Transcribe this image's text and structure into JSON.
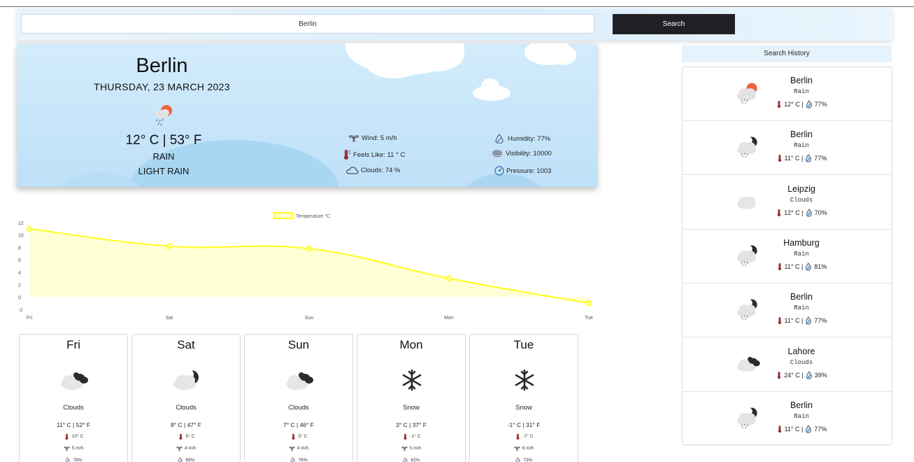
{
  "search": {
    "value": "Berlin",
    "button_label": "Search"
  },
  "current": {
    "city": "Berlin",
    "date": "THURSDAY, 23 MARCH 2023",
    "temp": "12° C | 53° F",
    "condition": "RAIN",
    "description": "LIGHT RAIN",
    "wind": "Wind: 5 m/h",
    "feels_like": "Feels Like: 11 ° C",
    "clouds": "Clouds: 74 %",
    "humidity": "Humidity: 77%",
    "visibility": "Visibility: 10000",
    "pressure": "Pressure: 1003"
  },
  "chart_data": {
    "type": "line",
    "categories": [
      "Fri",
      "Sat",
      "Sun",
      "Mon",
      "Tue"
    ],
    "series": [
      {
        "name": "Temperature °C",
        "values": [
          11,
          8.2,
          7.8,
          3,
          -1
        ]
      }
    ],
    "ylim": [
      -2,
      12
    ],
    "yticks": [
      -2,
      0,
      2,
      4,
      6,
      8,
      10,
      12
    ],
    "legend": "top-center",
    "fill": true,
    "line_color": "#ffff1a",
    "fill_color": "#ffffd6"
  },
  "forecast": [
    {
      "day": "Fri",
      "icon": "cloud-night-icon",
      "condition": "Clouds",
      "temp": "11° C | 52° F",
      "feels": "10° C",
      "wind": "5 m/h",
      "humidity": "78%"
    },
    {
      "day": "Sat",
      "icon": "cloud-moon-icon",
      "condition": "Clouds",
      "temp": "8° C | 47° F",
      "feels": "5° C",
      "wind": "4 m/h",
      "humidity": "69%"
    },
    {
      "day": "Sun",
      "icon": "cloud-night-icon",
      "condition": "Clouds",
      "temp": "7° C | 46° F",
      "feels": "5° C",
      "wind": "4 m/h",
      "humidity": "76%"
    },
    {
      "day": "Mon",
      "icon": "snowflake-icon",
      "condition": "Snow",
      "temp": "3° C | 37° F",
      "feels": "-1° C",
      "wind": "5 m/h",
      "humidity": "62%"
    },
    {
      "day": "Tue",
      "icon": "snowflake-icon",
      "condition": "Snow",
      "temp": "-1° C | 31° F",
      "feels": "-7° C",
      "wind": "6 m/h",
      "humidity": "73%"
    }
  ],
  "history": {
    "title": "Search History",
    "items": [
      {
        "city": "Berlin",
        "condition": "Rain",
        "temp": "12° C |",
        "humidity": "77%",
        "icon": "rain-sun-icon"
      },
      {
        "city": "Berlin",
        "condition": "Rain",
        "temp": "11° C |",
        "humidity": "77%",
        "icon": "rain-moon-icon"
      },
      {
        "city": "Leipzig",
        "condition": "Clouds",
        "temp": "12° C |",
        "humidity": "70%",
        "icon": "cloud-icon"
      },
      {
        "city": "Hamburg",
        "condition": "Rain",
        "temp": "11° C |",
        "humidity": "81%",
        "icon": "rain-moon-icon"
      },
      {
        "city": "Berlin",
        "condition": "Rain",
        "temp": "11° C |",
        "humidity": "77%",
        "icon": "rain-moon-icon"
      },
      {
        "city": "Lahore",
        "condition": "Clouds",
        "temp": "24° C |",
        "humidity": "39%",
        "icon": "cloud-night-icon"
      },
      {
        "city": "Berlin",
        "condition": "Rain",
        "temp": "11° C |",
        "humidity": "77%",
        "icon": "rain-moon-icon"
      }
    ]
  },
  "colors": {
    "accent": "#202124",
    "chart_line": "#ffff1a",
    "sun": "#f0643c"
  }
}
